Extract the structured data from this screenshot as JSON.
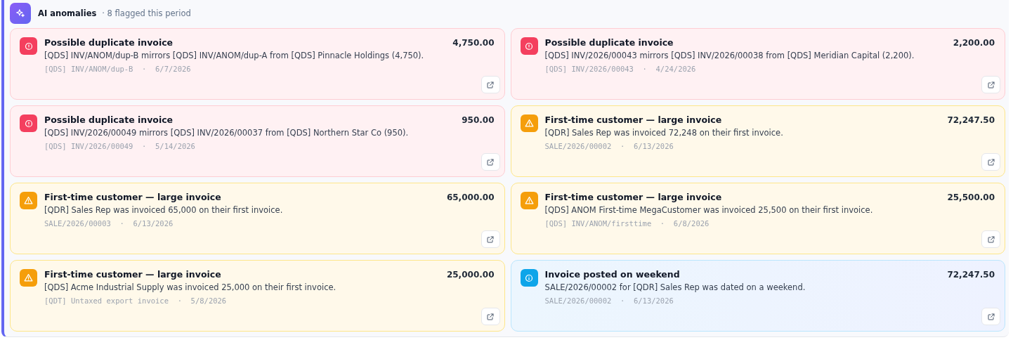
{
  "header": {
    "title": "AI anomalies",
    "subtitle": "· 8 flagged this period"
  },
  "anomalies": [
    {
      "kind": "error",
      "title": "Possible duplicate invoice",
      "amount": "4,750.00",
      "description": "[QDS] INV/ANOM/dup-B mirrors [QDS] INV/ANOM/dup-A from [QDS] Pinnacle Holdings (4,750).",
      "meta": "[QDS] INV/ANOM/dup-B  ·  6/7/2026"
    },
    {
      "kind": "error",
      "title": "Possible duplicate invoice",
      "amount": "2,200.00",
      "description": "[QDS] INV/2026/00043 mirrors [QDS] INV/2026/00038 from [QDS] Meridian Capital (2,200).",
      "meta": "[QDS] INV/2026/00043  ·  4/24/2026"
    },
    {
      "kind": "error",
      "title": "Possible duplicate invoice",
      "amount": "950.00",
      "description": "[QDS] INV/2026/00049 mirrors [QDS] INV/2026/00037 from [QDS] Northern Star Co (950).",
      "meta": "[QDS] INV/2026/00049  ·  5/14/2026"
    },
    {
      "kind": "warning",
      "title": "First-time customer — large invoice",
      "amount": "72,247.50",
      "description": "[QDR] Sales Rep was invoiced 72,248 on their first invoice.",
      "meta": "SALE/2026/00002  ·  6/13/2026"
    },
    {
      "kind": "warning",
      "title": "First-time customer — large invoice",
      "amount": "65,000.00",
      "description": "[QDR] Sales Rep was invoiced 65,000 on their first invoice.",
      "meta": "SALE/2026/00003  ·  6/13/2026"
    },
    {
      "kind": "warning",
      "title": "First-time customer — large invoice",
      "amount": "25,500.00",
      "description": "[QDS] ANOM First-time MegaCustomer was invoiced 25,500 on their first invoice.",
      "meta": "[QDS] INV/ANOM/firsttime  ·  6/8/2026"
    },
    {
      "kind": "warning",
      "title": "First-time customer — large invoice",
      "amount": "25,000.00",
      "description": "[QDS] Acme Industrial Supply was invoiced 25,000 on their first invoice.",
      "meta": "[QDT] Untaxed export invoice  ·  5/8/2026"
    },
    {
      "kind": "info",
      "title": "Invoice posted on weekend",
      "amount": "72,247.50",
      "description": "SALE/2026/00002 for [QDR] Sales Rep was dated on a weekend.",
      "meta": "SALE/2026/00002  ·  6/13/2026"
    }
  ]
}
